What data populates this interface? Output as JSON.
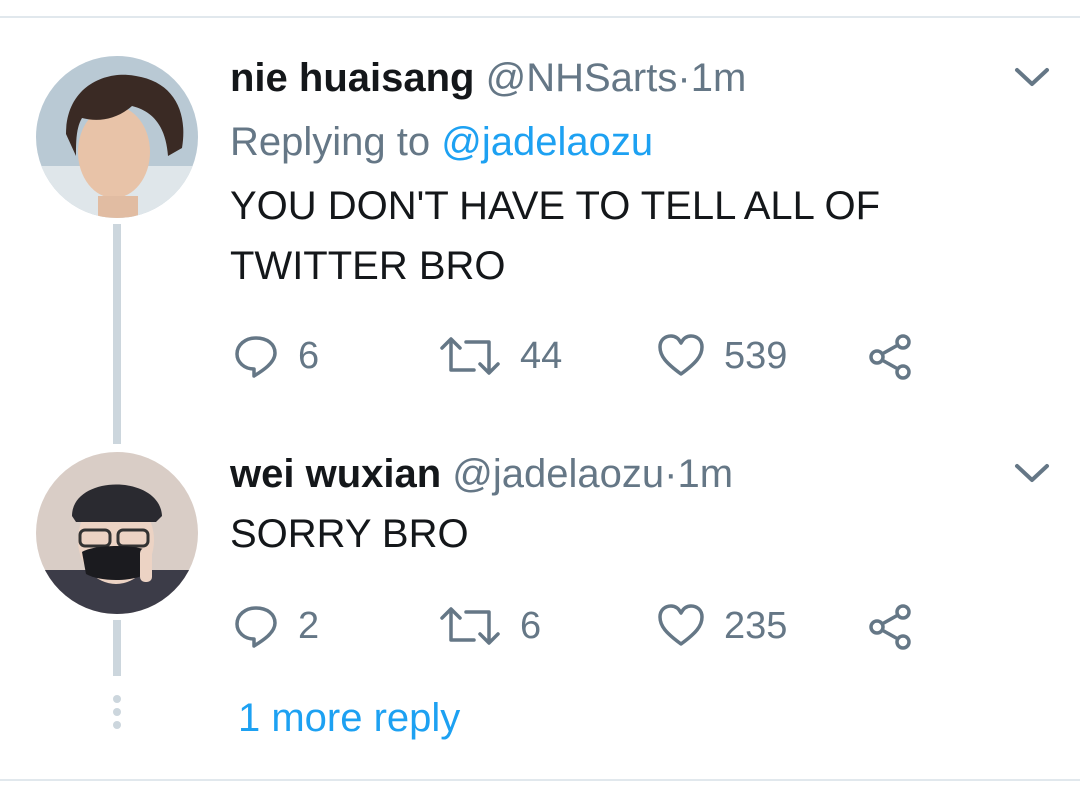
{
  "tweets": [
    {
      "display_name": "nie huaisang",
      "handle": "@NHSarts",
      "separator": "·",
      "time": "1m",
      "replying_prefix": "Replying to",
      "replying_handle": "@jadelaozu",
      "text_lines": [
        "YOU DON'T HAVE TO TELL ALL OF",
        "TWITTER BRO"
      ],
      "replies": "6",
      "retweets": "44",
      "likes": "539"
    },
    {
      "display_name": "wei wuxian",
      "handle": "@jadelaozu",
      "separator": "·",
      "time": "1m",
      "text_lines": [
        "SORRY BRO"
      ],
      "replies": "2",
      "retweets": "6",
      "likes": "235"
    }
  ],
  "more_replies_label": "1 more reply",
  "icons": {
    "reply": "reply-icon",
    "retweet": "retweet-icon",
    "like": "heart-icon",
    "share": "share-icon",
    "menu": "chevron-down-icon"
  },
  "colors": {
    "text": "#14171a",
    "secondary": "#657786",
    "link": "#1da1f2",
    "thread_line": "#ccd6dd",
    "divider": "#e1e8ed"
  }
}
